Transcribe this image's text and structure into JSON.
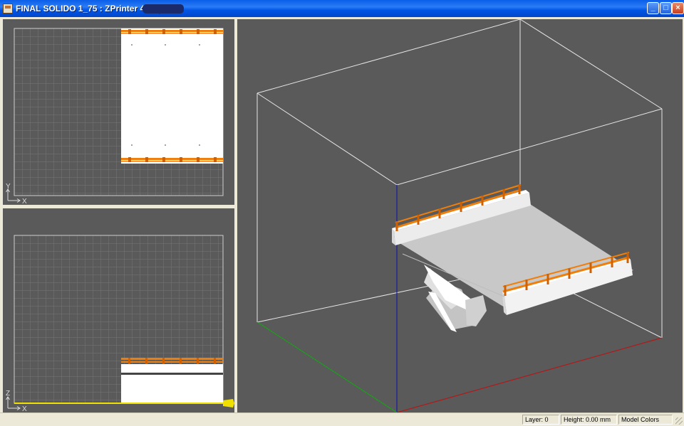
{
  "window": {
    "title": "FINAL SOLIDO 1_75 : ZPrinter 450 (3DP",
    "buttons": {
      "minimize": "_",
      "maximize": "□",
      "close": "×"
    }
  },
  "views": {
    "top": {
      "axis_v": "Y",
      "axis_h": "X"
    },
    "front": {
      "axis_v": "Z",
      "axis_h": "X"
    }
  },
  "statusbar": {
    "layer": "Layer: 0",
    "height": "Height: 0.00 mm",
    "mode": "Model Colors"
  },
  "colors": {
    "viewport_bg": "#5a5a5a",
    "grid_line": "#757575",
    "rail": "#ef7f0c",
    "model": "#d4d4d4",
    "axis_x": "#b01a1a",
    "axis_y": "#1aa01a",
    "axis_z": "#1a1aa0",
    "height_marker": "#f0e000"
  }
}
